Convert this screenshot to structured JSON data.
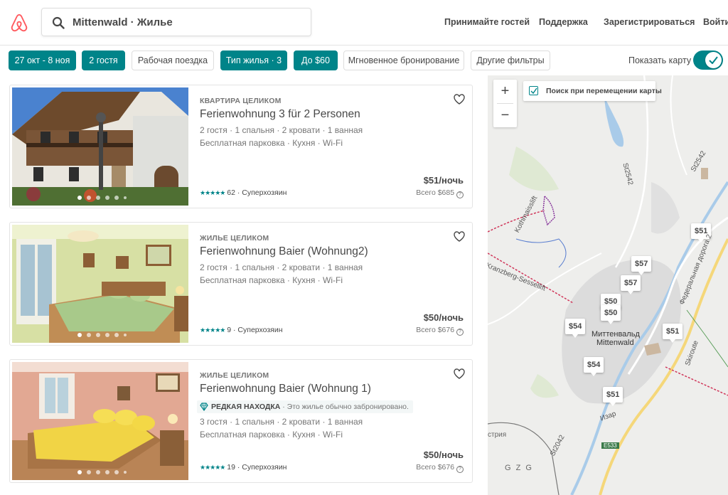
{
  "header": {
    "logo_icon": "airbnb-logo-icon",
    "search_query": "Mittenwald · Жилье",
    "nav": {
      "host": "Принимайте гостей",
      "help": "Поддержка",
      "signup": "Зарегистрироваться",
      "login": "Войти"
    }
  },
  "filters": {
    "dates": "27 окт - 8 ноя",
    "guests": "2 гостя",
    "work_trip": "Рабочая поездка",
    "home_type": "Тип жилья · 3",
    "price": "До $60",
    "instant_book": "Мгновенное бронирование",
    "more_filters": "Другие фильтры",
    "show_map_label": "Показать карту",
    "show_map_on": true
  },
  "listings": [
    {
      "kind": "КВАРТИРА ЦЕЛИКОМ",
      "title": "Ferienwohnung 3 für 2 Personen",
      "details": "2 гостя · 1 спальня · 2 кровати · 1 ванная",
      "amenities": "Бесплатная парковка · Кухня · Wi-Fi",
      "stars": "★★★★★",
      "reviews": "62 · Суперхозяин",
      "price": "$51/ночь",
      "total": "Всего $685",
      "rare": null
    },
    {
      "kind": "ЖИЛЬЕ ЦЕЛИКОМ",
      "title": "Ferienwohnung Baier (Wohnung2)",
      "details": "2 гостя · 1 спальня · 2 кровати · 1 ванная",
      "amenities": "Бесплатная парковка · Кухня · Wi-Fi",
      "stars": "★★★★★",
      "reviews": "9 · Суперхозяин",
      "price": "$50/ночь",
      "total": "Всего $676",
      "rare": null
    },
    {
      "kind": "ЖИЛЬЕ ЦЕЛИКОМ",
      "title": "Ferienwohnung Baier (Wohnung 1)",
      "details": "3 гостя · 1 спальня · 2 кровати · 1 ванная",
      "amenities": "Бесплатная парковка · Кухня · Wi-Fi",
      "stars": "★★★★★",
      "reviews": "19 · Суперхозяин",
      "price": "$50/ночь",
      "total": "Всего $676",
      "rare": {
        "label": "РЕДКАЯ НАХОДКА",
        "text": " · Это жилье обычно забронировано."
      }
    }
  ],
  "map": {
    "zoom_in": "+",
    "zoom_out": "−",
    "search_on_move": "Поиск при перемещении карты",
    "pins": [
      "$51",
      "$57",
      "$57",
      "$50",
      "$50",
      "$54",
      "$51",
      "$54",
      "$51"
    ],
    "labels": {
      "town_ru": "Миттенвальд",
      "town_de": "Mittenwald",
      "road_fed": "Федеральная дорога 2",
      "skiroute": "Skiroute",
      "isar": "Изар",
      "kranzberg": "Kranzberg-Sessellift",
      "kothmann": "Kothmaisslift",
      "st2542a": "St2542",
      "st2542b": "St2542",
      "st2042": "St2042",
      "e533": "E533",
      "gzg": "G Z G",
      "striya": "стрия"
    }
  },
  "colors": {
    "accent": "#008489",
    "brand": "#FF5A5F",
    "text": "#484848",
    "muted": "#767676"
  }
}
